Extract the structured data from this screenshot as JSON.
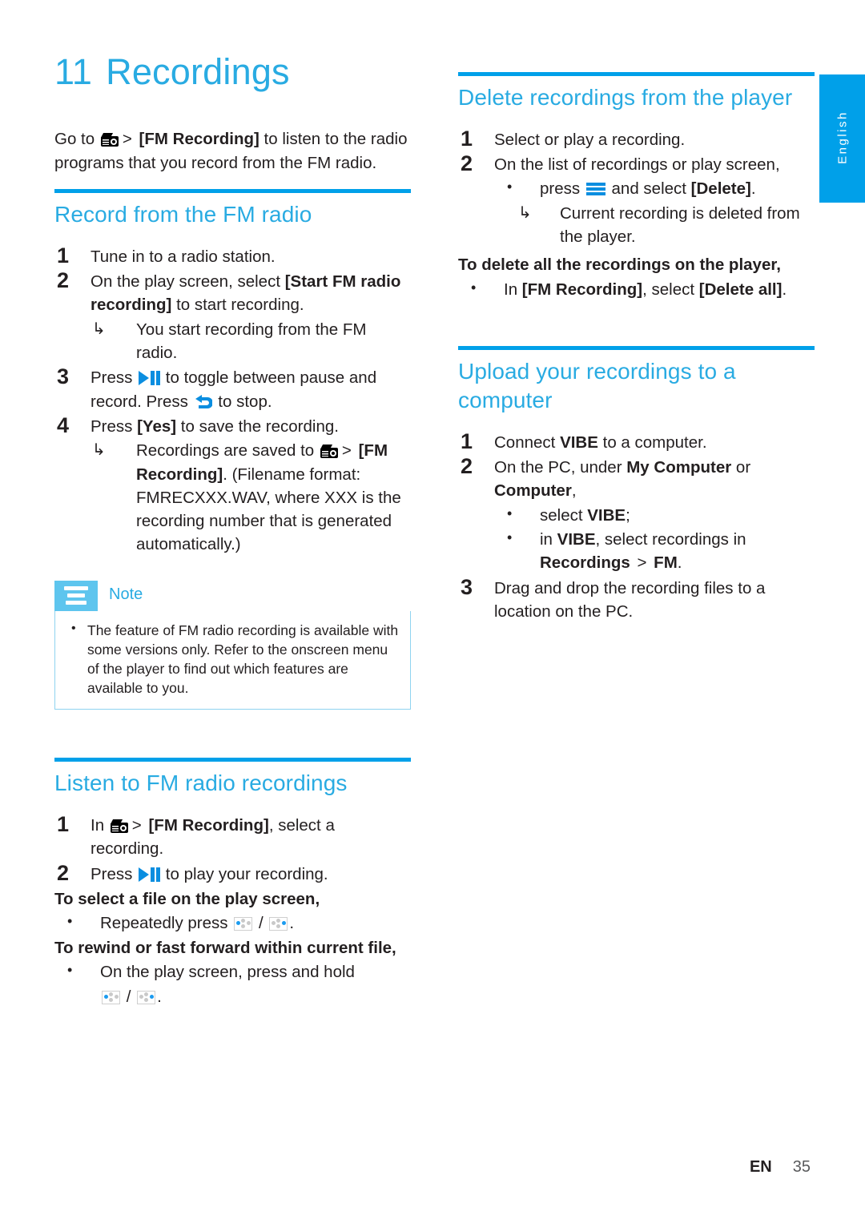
{
  "meta": {
    "language_tab": "English",
    "accent_blue": "#29abe2",
    "rule_blue": "#00a0e9",
    "note_blue": "#5ec5ee",
    "text_black": "#231f20"
  },
  "chapter": {
    "number": "11",
    "title": "Recordings"
  },
  "intro": {
    "pre": "Go to ",
    "gt": ">",
    "bracket": "[FM Recording]",
    "post": " to listen to the radio programs that you record from the FM radio."
  },
  "sections": {
    "record": {
      "heading": "Record from the FM radio",
      "steps": [
        {
          "num": "1",
          "text": "Tune in to a radio station."
        },
        {
          "num": "2",
          "lead": "On the play screen, select ",
          "bold": "[Start FM radio recording]",
          "tail": " to start recording.",
          "arrow": "You start recording from the FM radio."
        },
        {
          "num": "3",
          "lead": "Press ",
          "mid": " to toggle between pause and record. Press ",
          "tail": " to stop."
        },
        {
          "num": "4",
          "lead": "Press ",
          "bold": "[Yes]",
          "tail": " to save the recording.",
          "arrow_pre": "Recordings are saved to ",
          "arrow_gt": ">",
          "arrow_bold": "[FM Recording]",
          "arrow_post": ". (Filename format: FMRECXXX.WAV, where XXX is the recording number that is generated automatically.)"
        }
      ]
    },
    "note": {
      "label": "Note",
      "items": [
        "The feature of FM radio recording is available with some versions only. Refer to the onscreen menu of the player to find out which features are available to you."
      ]
    },
    "listen": {
      "heading": "Listen to FM radio recordings",
      "steps": [
        {
          "num": "1",
          "lead": "In ",
          "gt": ">",
          "bold": "[FM Recording]",
          "tail": ", select a recording."
        },
        {
          "num": "2",
          "lead": "Press ",
          "tail": " to play your recording."
        }
      ],
      "subhead_select": "To select a file on the play screen,",
      "bullet_select": "Repeatedly press",
      "subhead_rewind": "To rewind or fast forward within current file,",
      "bullet_rewind": "On the play screen, press and hold"
    },
    "delete": {
      "heading": "Delete recordings from the player",
      "steps": [
        {
          "num": "1",
          "text": "Select or play a recording."
        },
        {
          "num": "2",
          "text": "On the list of recordings or play screen,",
          "bullet_pre": "press ",
          "bullet_mid": " and select ",
          "bullet_bold": "[Delete]",
          "bullet_tail": ".",
          "arrow": "Current recording is deleted from the player."
        }
      ],
      "subhead_all": "To delete all the recordings on the player,",
      "bullet_all_pre": "In ",
      "bullet_all_bold1": "[FM Recording]",
      "bullet_all_mid": ", select ",
      "bullet_all_bold2": "[Delete all]",
      "bullet_all_tail": "."
    },
    "upload": {
      "heading": "Upload your recordings to a computer",
      "steps": [
        {
          "num": "1",
          "lead": "Connect ",
          "bold": "VIBE",
          "tail": " to a computer."
        },
        {
          "num": "2",
          "lead": "On the PC, under ",
          "bold": "My Computer",
          "mid": " or ",
          "bold2": "Computer",
          "tail": ",",
          "bullets": [
            {
              "pre": "select ",
              "bold": "VIBE",
              "tail": ";"
            },
            {
              "pre": "in ",
              "bold": "VIBE",
              "mid": ", select recordings in ",
              "bold2": "Recordings",
              "gt": ">",
              "bold3": "FM",
              "tail": "."
            }
          ]
        },
        {
          "num": "3",
          "text": "Drag and drop the recording files to a location on the PC."
        }
      ]
    }
  },
  "footer": {
    "lang_code": "EN",
    "page_number": "35"
  }
}
